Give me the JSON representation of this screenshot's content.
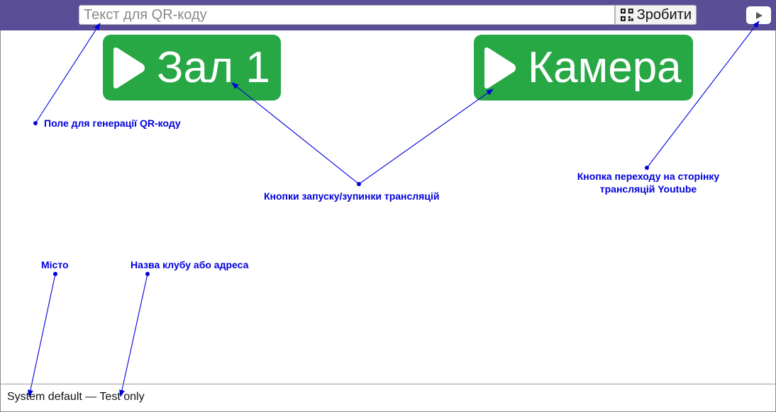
{
  "header": {
    "qr_input_placeholder": "Текст для QR-коду",
    "qr_button_label": "Зробити"
  },
  "stream_buttons": {
    "hall_label": "Зал 1",
    "camera_label": "Камера"
  },
  "annotations": {
    "qr_field": "Поле для генерації QR-коду",
    "stream_buttons": "Кнопки запуску/зупинки трансляцій",
    "youtube_line1": "Кнопка переходу на сторінку",
    "youtube_line2": "трансляцій Youtube",
    "city": "Місто",
    "club": "Назва клубу або адреса"
  },
  "footer": {
    "status_text": "System default — Test only"
  },
  "colors": {
    "header_bg": "#5a4f96",
    "stream_button_bg": "#28a745",
    "annotation": "#0000dd"
  },
  "icons": {
    "qr_button": "qr-code-icon",
    "youtube_button": "play-icon",
    "stream_buttons": "play-icon"
  }
}
